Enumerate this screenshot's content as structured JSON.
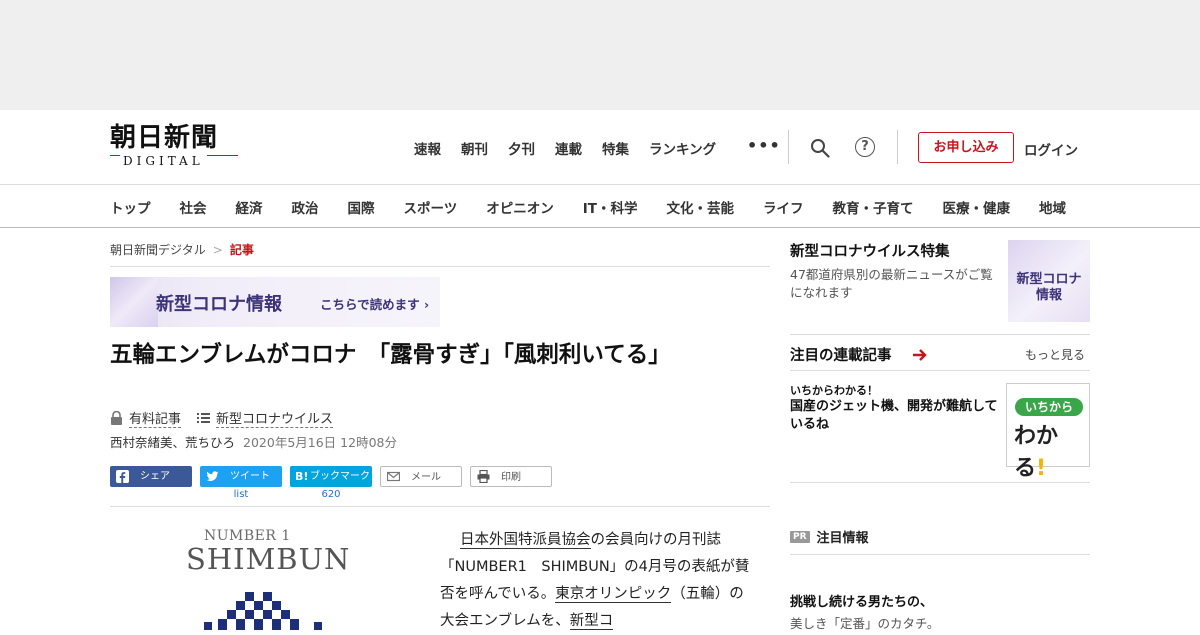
{
  "logo": {
    "line1": "朝日新聞",
    "line2": "DIGITAL"
  },
  "topnav": [
    "速報",
    "朝刊",
    "夕刊",
    "連載",
    "特集",
    "ランキング"
  ],
  "topnav_more": "•••",
  "header": {
    "apply_label": "お申し込み",
    "login_label": "ログイン",
    "help_label": "?"
  },
  "categories": [
    "トップ",
    "社会",
    "経済",
    "政治",
    "国際",
    "スポーツ",
    "オピニオン",
    "IT・科学",
    "文化・芸能",
    "ライフ",
    "教育・子育て",
    "医療・健康",
    "地域"
  ],
  "breadcrumb": {
    "home": "朝日新聞デジタル",
    "sep": ">",
    "current": "記事"
  },
  "corona_banner": {
    "title": "新型コロナ情報",
    "link": "こちらで読めます ›"
  },
  "article": {
    "headline": "五輪エンブレムがコロナ　「露骨すぎ」「風刺利いてる」",
    "paid_label": "有料記事",
    "topic_label": "新型コロナウイルス",
    "authors": "西村奈緒美、荒ちひろ",
    "date": "2020年5月16日 12時08分",
    "body_parts": [
      "日本外国特派員協会",
      "の会員向けの月刊誌「NUMBER1　SHIMBUN」の4月号の表紙が賛否を呼んでいる。",
      "東京オリンピック",
      "（五輪）の大会エンブレムを、",
      "新型コ"
    ]
  },
  "share": {
    "facebook": "シェア",
    "twitter": "ツイート",
    "twitter_count": "list",
    "hatena": "ブックマーク",
    "hatena_badge": "B!",
    "hatena_count": "620",
    "mail": "メール",
    "print": "印刷"
  },
  "cover": {
    "line1": "NUMBER 1",
    "line2": "SHIMBUN"
  },
  "sidebar": {
    "feature_title": "新型コロナウイルス特集",
    "feature_desc": "47都道府県別の最新ニュースがご覧になれます",
    "feature_thumb": [
      "新型コロナ",
      "情報"
    ],
    "series_title": "注目の連載記事",
    "series_more": "もっと見る",
    "series_kicker": "いちからわかる！",
    "series_item": "国産のジェット機、開発が難航しているね",
    "wakaru_pill": "いちから",
    "wakaru_big": "わかる",
    "wakaru_ex": "!",
    "pr_badge": "PR",
    "pr_title": "注目情報",
    "pr_item_title": "挑戦し続ける男たちの、",
    "pr_item_sub": "美しき「定番」のカタチ。"
  },
  "colors": {
    "brand_red": "#c4161c",
    "facebook": "#3b5998",
    "twitter": "#1da1f2",
    "hatena": "#00a4de",
    "corona_purple": "#3d3478"
  }
}
